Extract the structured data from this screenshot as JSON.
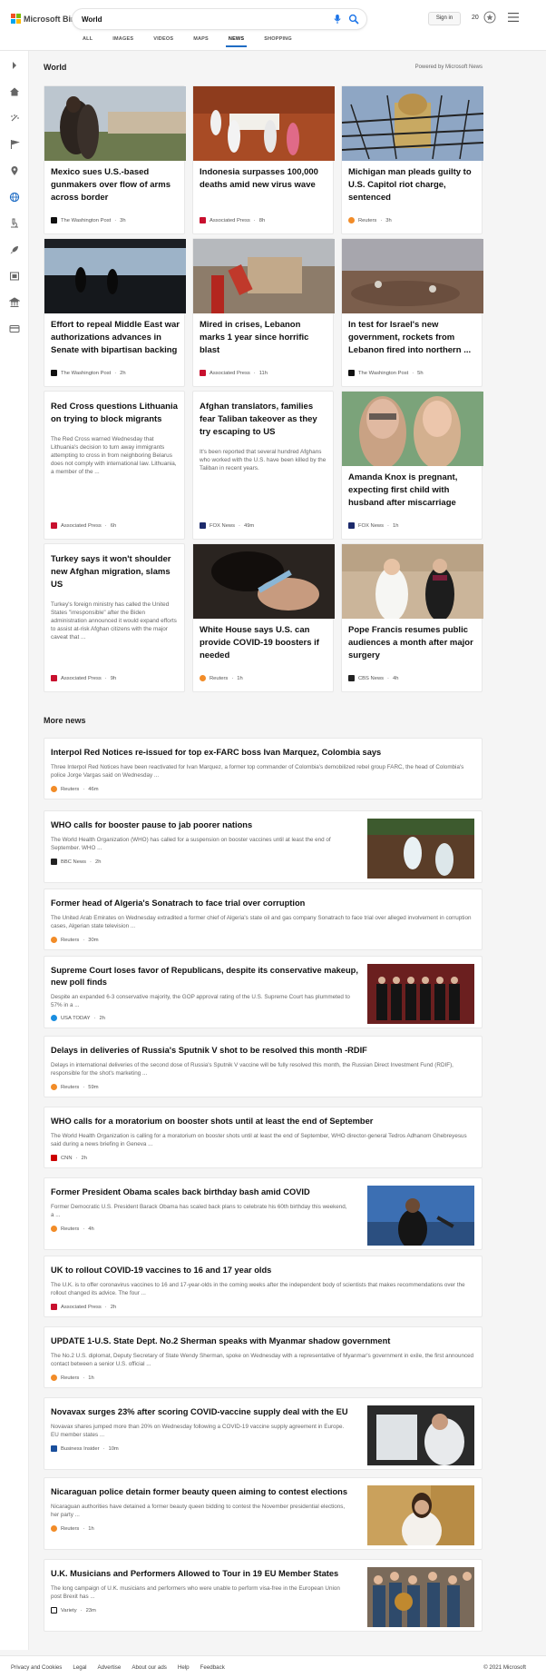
{
  "header": {
    "logo_text": "Microsoft Bing",
    "search_value": "World",
    "signin_label": "Sign in",
    "rewards_count": "20",
    "tabs": [
      {
        "label": "ALL"
      },
      {
        "label": "IMAGES"
      },
      {
        "label": "VIDEOS"
      },
      {
        "label": "MAPS"
      },
      {
        "label": "NEWS"
      },
      {
        "label": "SHOPPING"
      }
    ],
    "active_tab": "NEWS"
  },
  "sidebar": {
    "icons": [
      "chevron-right-icon",
      "home-icon",
      "sparkle-icon",
      "flag-icon",
      "location-pin-icon",
      "globe-icon",
      "microscope-icon",
      "rocket-icon",
      "film-icon",
      "government-icon",
      "credit-card-icon"
    ]
  },
  "world": {
    "section_title": "World",
    "powered_by": "Powered by Microsoft News",
    "cards": [
      {
        "title": "Mexico sues U.S.-based gunmakers over flow of arms across border",
        "source": "The Washington Post",
        "time": "3h",
        "source_color": "#111111"
      },
      {
        "title": "Indonesia surpasses 100,000 deaths amid new virus wave",
        "source": "Associated Press",
        "time": "8h",
        "source_color": "#c8102e"
      },
      {
        "title": "Michigan man pleads guilty to U.S. Capitol riot charge, sentenced",
        "source": "Reuters",
        "time": "3h",
        "source_color": "#f28c28"
      },
      {
        "title": "Effort to repeal Middle East war authorizations advances in Senate with bipartisan backing",
        "source": "The Washington Post",
        "time": "2h",
        "source_color": "#111111"
      },
      {
        "title": "Mired in crises, Lebanon marks 1 year since horrific blast",
        "source": "Associated Press",
        "time": "11h",
        "source_color": "#c8102e"
      },
      {
        "title": "In test for Israel's new government, rockets from Lebanon fired into northern ...",
        "source": "The Washington Post",
        "time": "5h",
        "source_color": "#111111"
      },
      {
        "title": "Red Cross questions Lithuania on trying to block migrants",
        "snippet": "The Red Cross warned Wednesday that Lithuania's decision to turn away immigrants attempting to cross in from neighboring Belarus does not comply with international law. Lithuania, a member of the ...",
        "source": "Associated Press",
        "time": "6h",
        "source_color": "#c8102e"
      },
      {
        "title": "Afghan translators, families fear Taliban takeover as they try escaping to US",
        "snippet": "It's been reported that several hundred Afghans who worked with the U.S. have been killed by the Taliban in recent years.",
        "source": "FOX News",
        "time": "49m",
        "source_color": "#1c2a6b"
      },
      {
        "title": "Amanda Knox is pregnant, expecting first child with husband after miscarriage",
        "source": "FOX News",
        "time": "1h",
        "source_color": "#1c2a6b"
      },
      {
        "title": "Turkey says it won't shoulder new Afghan migration, slams US",
        "snippet": "Turkey's foreign ministry has called the United States \"irresponsible\" after the Biden administration announced it would expand efforts to assist at-risk Afghan citizens with the major caveat that ...",
        "source": "Associated Press",
        "time": "9h",
        "source_color": "#c8102e"
      },
      {
        "title": "White House says U.S. can provide COVID-19 boosters if needed",
        "source": "Reuters",
        "time": "1h",
        "source_color": "#f28c28"
      },
      {
        "title": "Pope Francis resumes public audiences a month after major surgery",
        "source": "CBS News",
        "time": "4h",
        "source_color": "#222222"
      }
    ]
  },
  "more_news": {
    "section_title": "More news",
    "items": [
      {
        "title": "Interpol Red Notices re-issued for top ex-FARC boss Ivan Marquez, Colombia says",
        "snippet": "Three Interpol Red Notices have been reactivated for Ivan Marquez, a former top commander of Colombia's demobilized rebel group FARC, the head of Colombia's police Jorge Vargas said on Wednesday ...",
        "source": "Reuters",
        "time": "46m",
        "source_color": "#f28c28"
      },
      {
        "title": "WHO calls for booster pause to jab poorer nations",
        "snippet": "The World Health Organization (WHO) has called for a suspension on booster vaccines until at least the end of September. WHO ...",
        "source": "BBC News",
        "time": "2h",
        "source_color": "#222222"
      },
      {
        "title": "Former head of Algeria's Sonatrach to face trial over corruption",
        "snippet": "The United Arab Emirates on Wednesday extradited a former chief of Algeria's state oil and gas company Sonatrach to face trial over alleged involvement in corruption cases, Algerian state television ...",
        "source": "Reuters",
        "time": "30m",
        "source_color": "#f28c28"
      },
      {
        "title": "Supreme Court loses favor of Republicans, despite its conservative makeup, new poll finds",
        "snippet": "Despite an expanded 6-3 conservative majority, the GOP approval rating of the U.S. Supreme Court has plummeted to 57% in a ...",
        "source": "USA TODAY",
        "time": "2h",
        "source_color": "#1a8ee0"
      },
      {
        "title": "Delays in deliveries of Russia's Sputnik V shot to be resolved this month -RDIF",
        "snippet": "Delays in international deliveries of the second dose of Russia's Sputnik V vaccine will be fully resolved this month, the Russian Direct Investment Fund (RDIF), responsible for the shot's marketing ...",
        "source": "Reuters",
        "time": "59m",
        "source_color": "#f28c28"
      },
      {
        "title": "WHO calls for a moratorium on booster shots until at least the end of September",
        "snippet": "The World Health Organization is calling for a moratorium on booster shots until at least the end of September, WHO director-general Tedros Adhanom Ghebreyesus said during a news briefing in Geneva ...",
        "source": "CNN",
        "time": "2h",
        "source_color": "#cc0000"
      },
      {
        "title": "Former President Obama scales back birthday bash amid COVID",
        "snippet": "Former Democratic U.S. President Barack Obama has scaled back plans to celebrate his 60th birthday this weekend, a ...",
        "source": "Reuters",
        "time": "4h",
        "source_color": "#f28c28"
      },
      {
        "title": "UK to rollout COVID-19 vaccines to 16 and 17 year olds",
        "snippet": "The U.K. is to offer coronavirus vaccines to 16 and 17-year-olds in the coming weeks after the independent body of scientists that makes recommendations over the rollout changed its advice. The four ...",
        "source": "Associated Press",
        "time": "2h",
        "source_color": "#c8102e"
      },
      {
        "title": "UPDATE 1-U.S. State Dept. No.2 Sherman speaks with Myanmar shadow government",
        "snippet": "The No.2 U.S. diplomat, Deputy Secretary of State Wendy Sherman, spoke on Wednesday with a representative of Myanmar's government in exile, the first announced contact between a senior U.S. official ...",
        "source": "Reuters",
        "time": "1h",
        "source_color": "#f28c28"
      },
      {
        "title": "Novavax surges 23% after scoring COVID-vaccine supply deal with the EU",
        "snippet": "Novavax shares jumped more than 20% on Wednesday following a COVID-19 vaccine supply agreement in Europe. EU member states ...",
        "source": "Business Insider",
        "time": "10m",
        "source_color": "#1a4f9c"
      },
      {
        "title": "Nicaraguan police detain former beauty queen aiming to contest elections",
        "snippet": "Nicaraguan authorities have detained a former beauty queen bidding to contest the November presidential elections, her party ...",
        "source": "Reuters",
        "time": "1h",
        "source_color": "#f28c28"
      },
      {
        "title": "U.K. Musicians and Performers Allowed to Tour in 19 EU Member States",
        "snippet": "The long campaign of U.K. musicians and performers who were unable to perform visa-free in the European Union post Brexit has ...",
        "source": "Variety",
        "time": "23m",
        "source_color": "#111111"
      }
    ]
  },
  "footer": {
    "links": [
      "Privacy and Cookies",
      "Legal",
      "Advertise",
      "About our ads",
      "Help",
      "Feedback"
    ],
    "copyright": "© 2021 Microsoft"
  }
}
